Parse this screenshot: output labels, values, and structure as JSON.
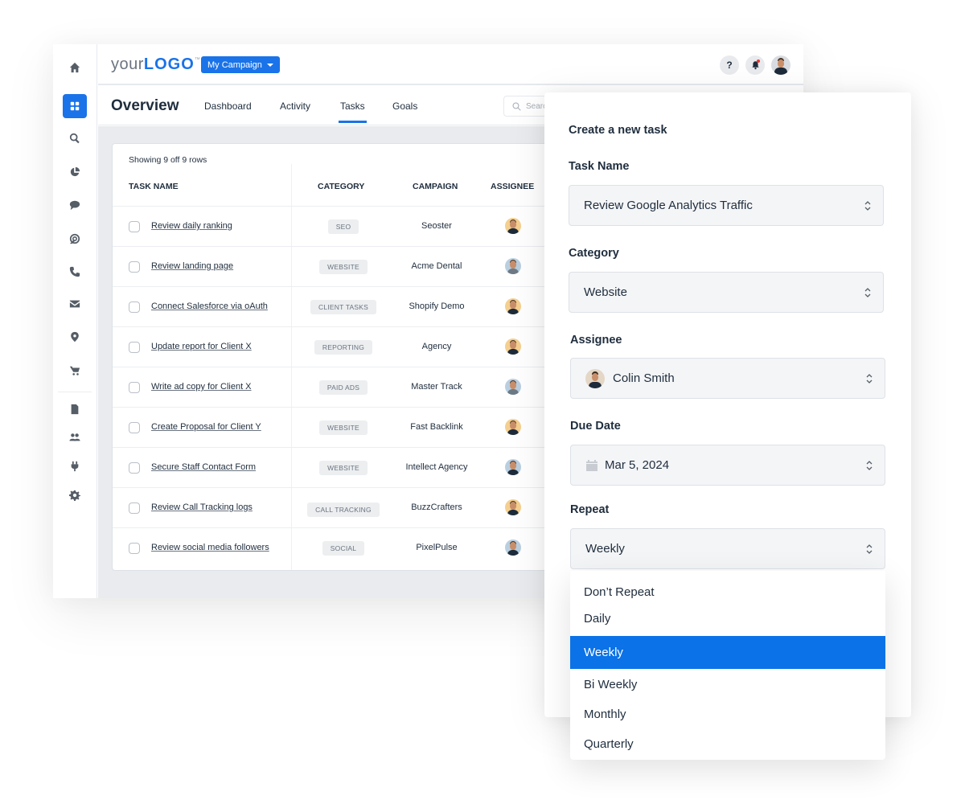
{
  "app": {
    "logo": {
      "prefix": "your",
      "brand": "LOGO",
      "tm": "™"
    },
    "campaign_button": "My Campaign",
    "help_label": "?",
    "accent_color": "#1a73e8"
  },
  "sidebar": {
    "items": [
      {
        "name": "home",
        "icon": "home-icon"
      },
      {
        "name": "overview",
        "icon": "grid-icon",
        "active": true
      },
      {
        "name": "search",
        "icon": "search-icon"
      },
      {
        "name": "reports",
        "icon": "pie-chart-icon"
      },
      {
        "name": "chat",
        "icon": "chat-icon"
      },
      {
        "name": "seo",
        "icon": "target-icon"
      },
      {
        "name": "calls",
        "icon": "phone-icon"
      },
      {
        "name": "email",
        "icon": "mail-icon"
      },
      {
        "name": "local",
        "icon": "map-pin-icon"
      },
      {
        "name": "ecommerce",
        "icon": "cart-icon"
      },
      {
        "name": "documents",
        "icon": "document-icon"
      },
      {
        "name": "users",
        "icon": "users-icon"
      },
      {
        "name": "integrations",
        "icon": "plug-icon"
      },
      {
        "name": "settings",
        "icon": "gear-icon"
      }
    ]
  },
  "subnav": {
    "title": "Overview",
    "tabs": [
      {
        "label": "Dashboard"
      },
      {
        "label": "Activity"
      },
      {
        "label": "Tasks",
        "active": true
      },
      {
        "label": "Goals"
      }
    ],
    "search_placeholder": "Search"
  },
  "table": {
    "showing": "Showing 9 off 9 rows",
    "headers": {
      "task": "TASK NAME",
      "category": "CATEGORY",
      "campaign": "CAMPAIGN",
      "assignee": "ASSIGNEE"
    },
    "rows": [
      {
        "task": "Review daily ranking",
        "category": "SEO",
        "campaign": "Seoster",
        "avatar": "warm"
      },
      {
        "task": "Review landing page",
        "category": "WEBSITE",
        "campaign": "Acme Dental",
        "avatar": "cool"
      },
      {
        "task": "Connect Salesforce via oAuth",
        "category": "CLIENT TASKS",
        "campaign": "Shopify Demo",
        "avatar": "warm"
      },
      {
        "task": "Update report for Client X",
        "category": "REPORTING",
        "campaign": "Agency",
        "avatar": "warm"
      },
      {
        "task": "Write ad copy for Client X",
        "category": "PAID ADS",
        "campaign": "Master Track",
        "avatar": "cool"
      },
      {
        "task": "Create Proposal for Client Y",
        "category": "WEBSITE",
        "campaign": "Fast Backlink",
        "avatar": "warm"
      },
      {
        "task": "Secure Staff Contact Form",
        "category": "WEBSITE",
        "campaign": "Intellect Agency",
        "avatar": "cool"
      },
      {
        "task": "Review Call Tracking logs",
        "category": "CALL TRACKING",
        "campaign": "BuzzCrafters",
        "avatar": "warm"
      },
      {
        "task": "Review social media followers",
        "category": "SOCIAL",
        "campaign": "PixelPulse",
        "avatar": "cool"
      }
    ]
  },
  "panel": {
    "title": "Create a new task",
    "fields": {
      "task_name": {
        "label": "Task Name",
        "value": "Review Google Analytics Traffic"
      },
      "category": {
        "label": "Category",
        "value": "Website"
      },
      "assignee": {
        "label": "Assignee",
        "value": "Colin Smith"
      },
      "due_date": {
        "label": "Due Date",
        "value": "Mar 5, 2024"
      },
      "repeat": {
        "label": "Repeat",
        "value": "Weekly"
      }
    },
    "repeat_options": [
      {
        "label": "Don’t Repeat"
      },
      {
        "label": "Daily"
      },
      {
        "label": "Weekly",
        "selected": true
      },
      {
        "label": "Bi Weekly"
      },
      {
        "label": "Monthly"
      },
      {
        "label": "Quarterly"
      }
    ],
    "selected_color": "#0b72e7"
  }
}
